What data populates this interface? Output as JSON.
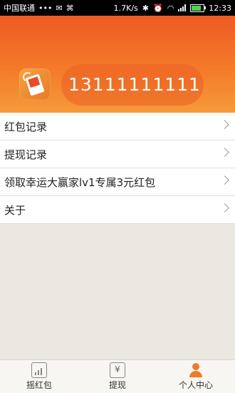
{
  "status_bar": {
    "carrier": "中国联通",
    "dots": "•••",
    "speed": "1.7K/s",
    "time": "12:33"
  },
  "profile": {
    "phone": "13111111111"
  },
  "menu": {
    "items": [
      {
        "label": "红包记录"
      },
      {
        "label": "提现记录"
      },
      {
        "label": "领取幸运大赢家lv1专属3元红包"
      },
      {
        "label": "关于"
      }
    ]
  },
  "tabbar": {
    "tabs": [
      {
        "label": "摇红包",
        "icon": "chart-icon"
      },
      {
        "label": "提现",
        "icon": "yuan-icon"
      },
      {
        "label": "个人中心",
        "icon": "person-icon"
      }
    ],
    "active_color": "#f07a2a"
  },
  "colors": {
    "header_top": "#ef5a23",
    "header_bottom": "#f59a3a",
    "background": "#ebe8e2"
  }
}
